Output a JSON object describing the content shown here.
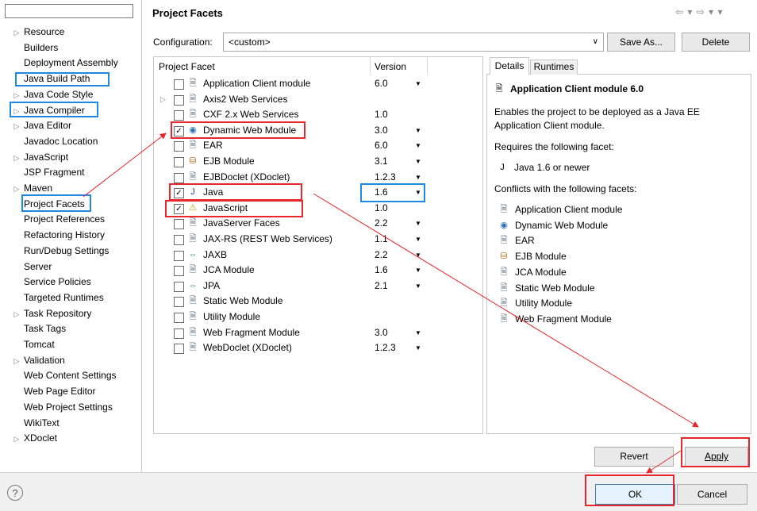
{
  "window": {
    "title": "Project Facets"
  },
  "tree": [
    {
      "label": "Resource",
      "expandable": true
    },
    {
      "label": "Builders",
      "expandable": false
    },
    {
      "label": "Deployment Assembly",
      "expandable": false
    },
    {
      "label": "Java Build Path",
      "expandable": false
    },
    {
      "label": "Java Code Style",
      "expandable": true
    },
    {
      "label": "Java Compiler",
      "expandable": true
    },
    {
      "label": "Java Editor",
      "expandable": true
    },
    {
      "label": "Javadoc Location",
      "expandable": false
    },
    {
      "label": "JavaScript",
      "expandable": true
    },
    {
      "label": "JSP Fragment",
      "expandable": false
    },
    {
      "label": "Maven",
      "expandable": true
    },
    {
      "label": "Project Facets",
      "expandable": false
    },
    {
      "label": "Project References",
      "expandable": false
    },
    {
      "label": "Refactoring History",
      "expandable": false
    },
    {
      "label": "Run/Debug Settings",
      "expandable": false
    },
    {
      "label": "Server",
      "expandable": false
    },
    {
      "label": "Service Policies",
      "expandable": false
    },
    {
      "label": "Targeted Runtimes",
      "expandable": false
    },
    {
      "label": "Task Repository",
      "expandable": true
    },
    {
      "label": "Task Tags",
      "expandable": false
    },
    {
      "label": "Tomcat",
      "expandable": false
    },
    {
      "label": "Validation",
      "expandable": true
    },
    {
      "label": "Web Content Settings",
      "expandable": false
    },
    {
      "label": "Web Page Editor",
      "expandable": false
    },
    {
      "label": "Web Project Settings",
      "expandable": false
    },
    {
      "label": "WikiText",
      "expandable": false
    },
    {
      "label": "XDoclet",
      "expandable": true
    }
  ],
  "configuration": {
    "label": "Configuration:",
    "value": "<custom>"
  },
  "buttons": {
    "save_as": "Save As...",
    "delete": "Delete",
    "revert": "Revert",
    "apply": "Apply",
    "ok": "OK",
    "cancel": "Cancel"
  },
  "table": {
    "col_facet": "Project Facet",
    "col_version": "Version",
    "rows": [
      {
        "name": "Application Client module",
        "version": "6.0",
        "dropdown": true,
        "checked": false,
        "expandable": false,
        "icon": "doc"
      },
      {
        "name": "Axis2 Web Services",
        "version": "",
        "dropdown": false,
        "checked": false,
        "expandable": true,
        "icon": "doc"
      },
      {
        "name": "CXF 2.x Web Services",
        "version": "1.0",
        "dropdown": false,
        "checked": false,
        "expandable": false,
        "icon": "doc"
      },
      {
        "name": "Dynamic Web Module",
        "version": "3.0",
        "dropdown": true,
        "checked": true,
        "expandable": false,
        "icon": "globe"
      },
      {
        "name": "EAR",
        "version": "6.0",
        "dropdown": true,
        "checked": false,
        "expandable": false,
        "icon": "doc"
      },
      {
        "name": "EJB Module",
        "version": "3.1",
        "dropdown": true,
        "checked": false,
        "expandable": false,
        "icon": "bean"
      },
      {
        "name": "EJBDoclet (XDoclet)",
        "version": "1.2.3",
        "dropdown": true,
        "checked": false,
        "expandable": false,
        "icon": "doc"
      },
      {
        "name": "Java",
        "version": "1.6",
        "dropdown": true,
        "checked": true,
        "expandable": false,
        "icon": "java"
      },
      {
        "name": "JavaScript",
        "version": "1.0",
        "dropdown": false,
        "checked": true,
        "expandable": false,
        "icon": "js"
      },
      {
        "name": "JavaServer Faces",
        "version": "2.2",
        "dropdown": true,
        "checked": false,
        "expandable": false,
        "icon": "doc"
      },
      {
        "name": "JAX-RS (REST Web Services)",
        "version": "1.1",
        "dropdown": true,
        "checked": false,
        "expandable": false,
        "icon": "doc"
      },
      {
        "name": "JAXB",
        "version": "2.2",
        "dropdown": true,
        "checked": false,
        "expandable": false,
        "icon": "jaxb"
      },
      {
        "name": "JCA Module",
        "version": "1.6",
        "dropdown": true,
        "checked": false,
        "expandable": false,
        "icon": "doc"
      },
      {
        "name": "JPA",
        "version": "2.1",
        "dropdown": true,
        "checked": false,
        "expandable": false,
        "icon": "jaxb"
      },
      {
        "name": "Static Web Module",
        "version": "",
        "dropdown": false,
        "checked": false,
        "expandable": false,
        "icon": "doc"
      },
      {
        "name": "Utility Module",
        "version": "",
        "dropdown": false,
        "checked": false,
        "expandable": false,
        "icon": "doc"
      },
      {
        "name": "Web Fragment Module",
        "version": "3.0",
        "dropdown": true,
        "checked": false,
        "expandable": false,
        "icon": "doc"
      },
      {
        "name": "WebDoclet (XDoclet)",
        "version": "1.2.3",
        "dropdown": true,
        "checked": false,
        "expandable": false,
        "icon": "doc"
      }
    ]
  },
  "details": {
    "tab_details": "Details",
    "tab_runtimes": "Runtimes",
    "heading": "Application Client module 6.0",
    "description": [
      "Enables the project to be deployed as a Java EE",
      "Application Client module."
    ],
    "requires_label": "Requires the following facet:",
    "requires": "Java 1.6 or newer",
    "conflicts_label": "Conflicts with the following facets:",
    "conflicts": [
      "Application Client module",
      "Dynamic Web Module",
      "EAR",
      "EJB Module",
      "JCA Module",
      "Static Web Module",
      "Utility Module",
      "Web Fragment Module"
    ],
    "conflict_icons": [
      "doc",
      "globe",
      "doc",
      "bean",
      "doc",
      "doc",
      "doc",
      "doc"
    ]
  },
  "help": "?",
  "colors": {
    "annotation_red": "#e8262b",
    "annotation_blue": "#1e88e5"
  }
}
